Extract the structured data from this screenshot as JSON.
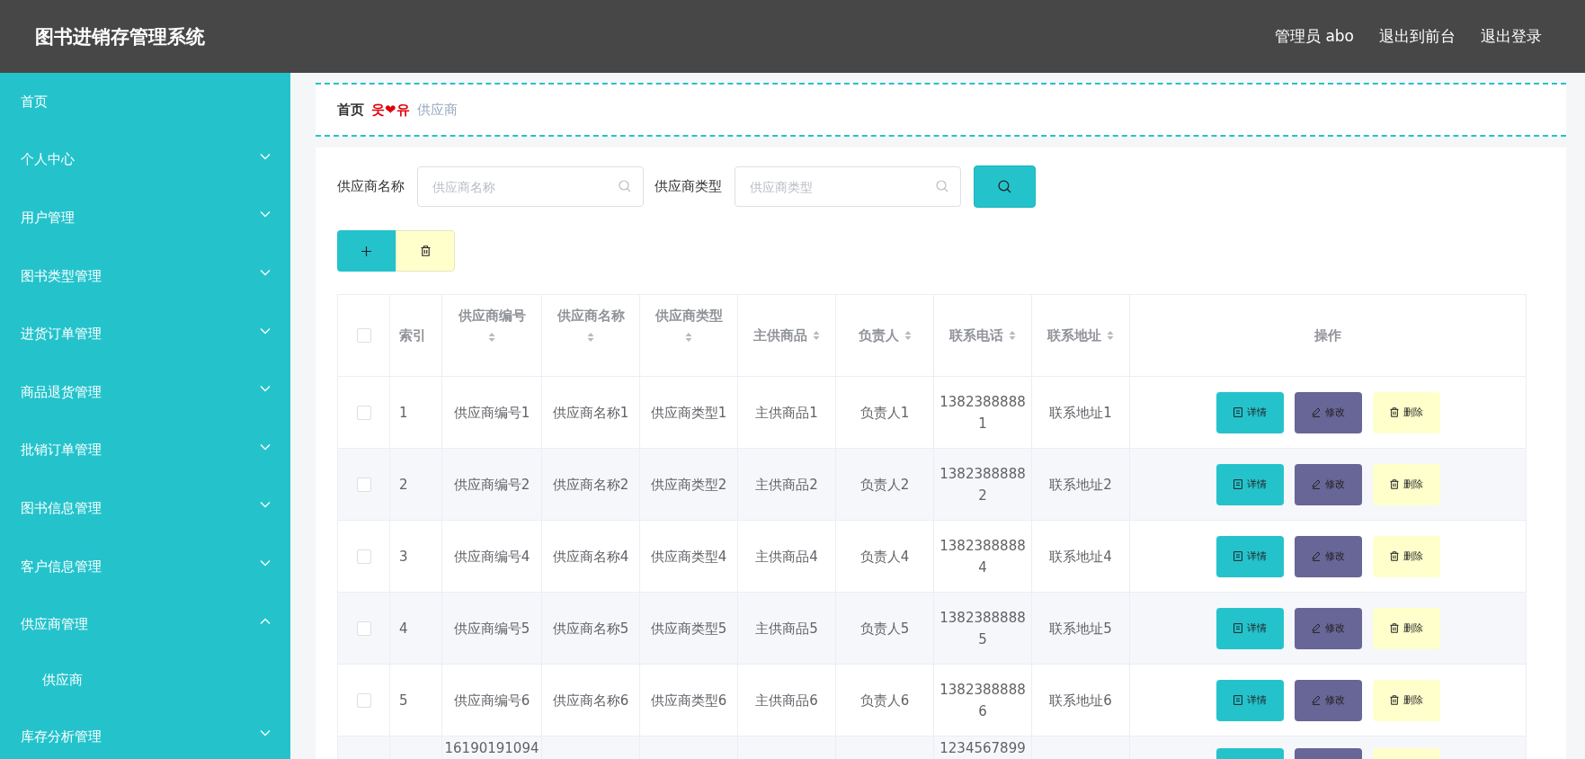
{
  "header": {
    "title": "图书进销存管理系统",
    "user": "管理员 abo",
    "links": [
      "退出到前台",
      "退出登录"
    ]
  },
  "sidebar": {
    "items": [
      {
        "label": "首页"
      },
      {
        "label": "个人中心",
        "expanded": false
      },
      {
        "label": "用户管理",
        "expanded": false
      },
      {
        "label": "图书类型管理",
        "expanded": false
      },
      {
        "label": "进货订单管理",
        "expanded": false
      },
      {
        "label": "商品退货管理",
        "expanded": false
      },
      {
        "label": "批销订单管理",
        "expanded": false
      },
      {
        "label": "图书信息管理",
        "expanded": false
      },
      {
        "label": "客户信息管理",
        "expanded": false
      },
      {
        "label": "供应商管理",
        "expanded": true,
        "children": [
          {
            "label": "供应商"
          }
        ]
      },
      {
        "label": "库存分析管理",
        "expanded": false
      }
    ]
  },
  "breadcrumb": {
    "home": "首页",
    "separator": "웃❤유",
    "current": "供应商"
  },
  "search": {
    "fields": [
      {
        "label": "供应商名称",
        "placeholder": "供应商名称"
      },
      {
        "label": "供应商类型",
        "placeholder": "供应商类型"
      }
    ]
  },
  "table": {
    "all_checked": false,
    "columns": [
      {
        "label": "索引",
        "sortable": false
      },
      {
        "label": "供应商编号",
        "sortable": true
      },
      {
        "label": "供应商名称",
        "sortable": true
      },
      {
        "label": "供应商类型",
        "sortable": true
      },
      {
        "label": "主供商品",
        "sortable": true
      },
      {
        "label": "负责人",
        "sortable": true
      },
      {
        "label": "联系电话",
        "sortable": true
      },
      {
        "label": "联系地址",
        "sortable": true
      },
      {
        "label": "操作",
        "sortable": false
      }
    ],
    "rows": [
      {
        "checked": false,
        "index": "1",
        "supplier_no": "供应商编号1",
        "supplier_name": "供应商名称1",
        "supplier_type": "供应商类型1",
        "main_goods": "主供商品1",
        "contact": "负责人1",
        "phone": "13823888881",
        "address": "联系地址1",
        "actions": [
          {
            "kind": "detail",
            "label": "详情"
          },
          {
            "kind": "edit",
            "label": "修改"
          },
          {
            "kind": "delete",
            "label": "删除"
          }
        ]
      },
      {
        "checked": false,
        "index": "2",
        "supplier_no": "供应商编号2",
        "supplier_name": "供应商名称2",
        "supplier_type": "供应商类型2",
        "main_goods": "主供商品2",
        "contact": "负责人2",
        "phone": "13823888882",
        "address": "联系地址2",
        "actions": [
          {
            "kind": "detail",
            "label": "详情"
          },
          {
            "kind": "edit",
            "label": "修改"
          },
          {
            "kind": "delete",
            "label": "删除"
          }
        ]
      },
      {
        "checked": false,
        "index": "3",
        "supplier_no": "供应商编号4",
        "supplier_name": "供应商名称4",
        "supplier_type": "供应商类型4",
        "main_goods": "主供商品4",
        "contact": "负责人4",
        "phone": "13823888884",
        "address": "联系地址4",
        "actions": [
          {
            "kind": "detail",
            "label": "详情"
          },
          {
            "kind": "edit",
            "label": "修改"
          },
          {
            "kind": "delete",
            "label": "删除"
          }
        ]
      },
      {
        "checked": false,
        "index": "4",
        "supplier_no": "供应商编号5",
        "supplier_name": "供应商名称5",
        "supplier_type": "供应商类型5",
        "main_goods": "主供商品5",
        "contact": "负责人5",
        "phone": "13823888885",
        "address": "联系地址5",
        "actions": [
          {
            "kind": "detail",
            "label": "详情"
          },
          {
            "kind": "edit",
            "label": "修改"
          },
          {
            "kind": "delete",
            "label": "删除"
          }
        ]
      },
      {
        "checked": false,
        "index": "5",
        "supplier_no": "供应商编号6",
        "supplier_name": "供应商名称6",
        "supplier_type": "供应商类型6",
        "main_goods": "主供商品6",
        "contact": "负责人6",
        "phone": "13823888886",
        "address": "联系地址6",
        "actions": [
          {
            "kind": "detail",
            "label": "详情"
          },
          {
            "kind": "edit",
            "label": "修改"
          },
          {
            "kind": "delete",
            "label": "删除"
          }
        ]
      },
      {
        "supplier_no": "16190191094",
        "phone": "1234567899",
        "actions": [
          {
            "kind": "detail"
          },
          {
            "kind": "edit"
          },
          {
            "kind": "delete"
          }
        ]
      }
    ]
  }
}
